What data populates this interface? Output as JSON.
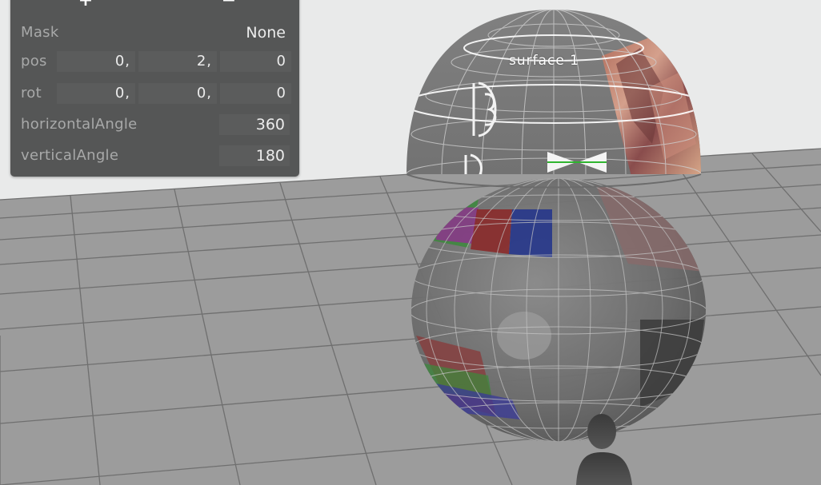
{
  "panel": {
    "add_label": "+",
    "remove_label": "−",
    "mask": {
      "label": "Mask",
      "value": "None"
    },
    "pos": {
      "label": "pos",
      "x": "0,",
      "y": "2,",
      "z": "0"
    },
    "rot": {
      "label": "rot",
      "x": "0,",
      "y": "0,",
      "z": "0"
    },
    "horizontalAngle": {
      "label": "horizontalAngle",
      "value": "360"
    },
    "verticalAngle": {
      "label": "verticalAngle",
      "value": "180"
    }
  },
  "scene": {
    "surface_label": "surface 1",
    "colors": {
      "background": "#e9eaea",
      "floor": "#9c9c9c",
      "grid": "#6e6e6e",
      "dome": "#7a7a7a",
      "panel": "#555656"
    },
    "icons": [
      "floor-grid",
      "sphere-mesh",
      "dome-mesh",
      "person-silhouette-icon",
      "bowtie-marker-icon"
    ]
  }
}
